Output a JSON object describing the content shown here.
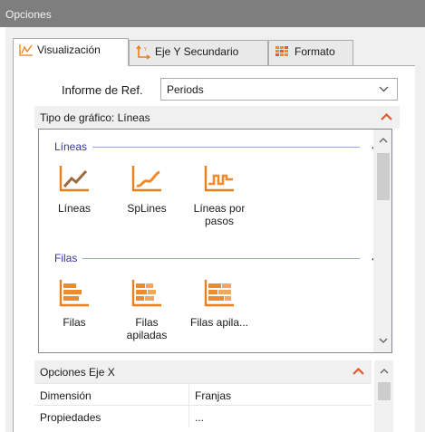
{
  "window": {
    "title": "Opciones"
  },
  "tabs": [
    {
      "label": "Visualización",
      "icon": "line-chart-icon",
      "active": true
    },
    {
      "label": "Eje Y Secundario",
      "icon": "secondary-axis-icon",
      "active": false
    },
    {
      "label": "Formato",
      "icon": "format-grid-icon",
      "active": false
    }
  ],
  "reference": {
    "label": "Informe de Ref.",
    "value": "Periods"
  },
  "chart_type_section": {
    "title": "Tipo de gráfico: Líneas"
  },
  "gallery": {
    "groups": [
      {
        "title": "Líneas",
        "items": [
          {
            "label": "Líneas",
            "icon": "lines-chart-icon",
            "selected": true
          },
          {
            "label": "SpLines",
            "icon": "splines-chart-icon"
          },
          {
            "label": "Líneas por pasos",
            "icon": "step-lines-chart-icon"
          }
        ]
      },
      {
        "title": "Filas",
        "items": [
          {
            "label": "Filas",
            "icon": "rows-chart-icon"
          },
          {
            "label": "Filas apiladas",
            "icon": "stacked-rows-chart-icon"
          },
          {
            "label": "Filas apila...",
            "icon": "stacked-rows-100-chart-icon"
          }
        ]
      }
    ]
  },
  "x_axis_section": {
    "title": "Opciones Eje X",
    "rows": [
      {
        "key": "Dimensión",
        "value": "Franjas"
      },
      {
        "key": "Propiedades",
        "value": "..."
      }
    ]
  },
  "colors": {
    "accent_orange": "#e8801a",
    "caret_red": "#e05a2a",
    "group_blue": "#3535a0",
    "titlebar": "#7e7e7e"
  }
}
